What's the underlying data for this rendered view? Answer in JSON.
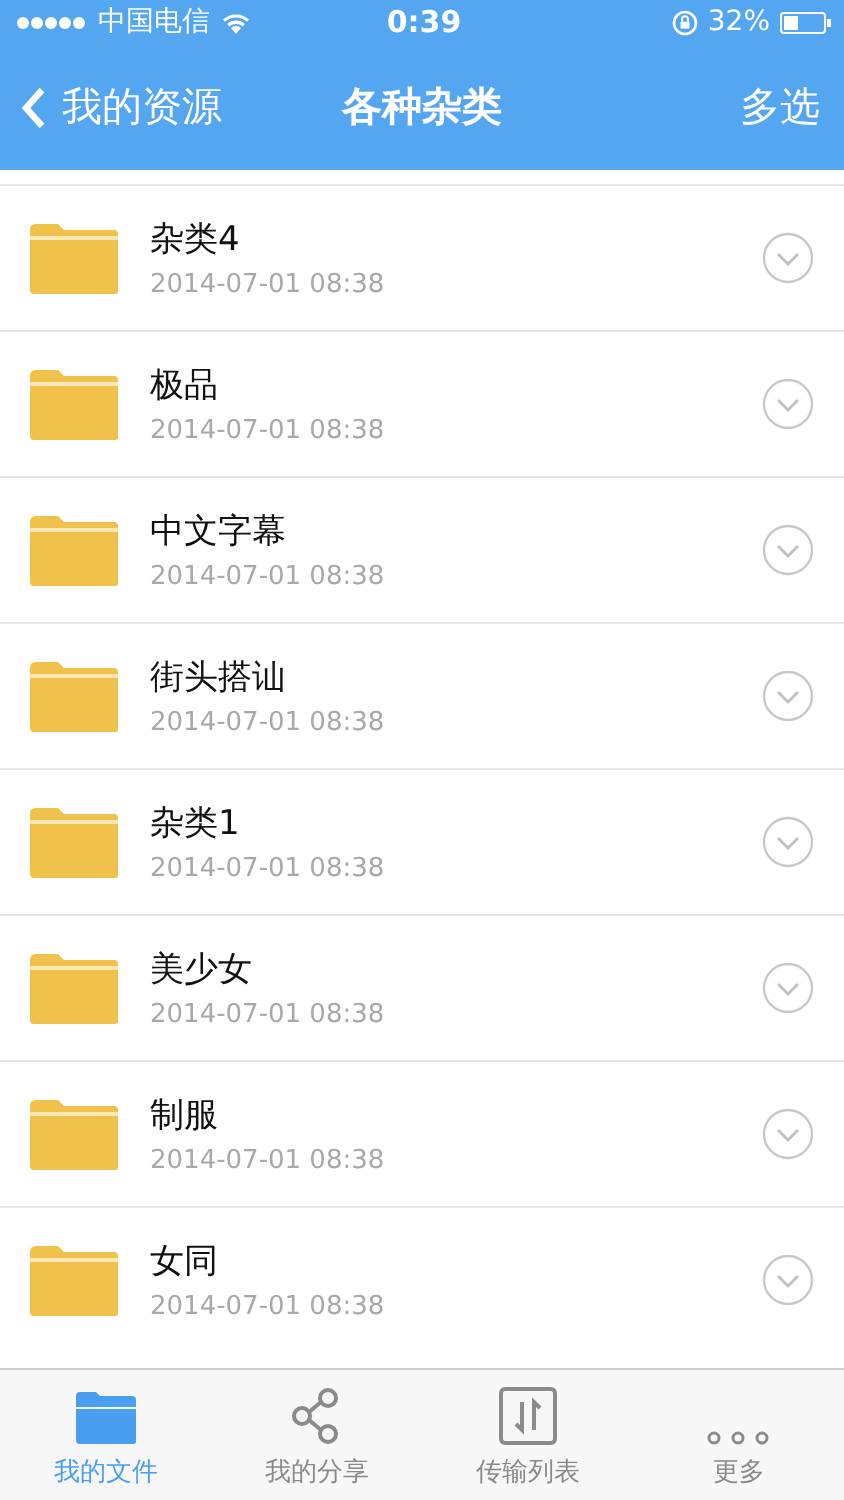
{
  "status_bar": {
    "carrier": "中国电信",
    "time": "0:39",
    "battery": "32%"
  },
  "nav": {
    "back": "我的资源",
    "title": "各种杂类",
    "action": "多选"
  },
  "files": [
    {
      "name": "杂类4",
      "date": "2014-07-01 08:38"
    },
    {
      "name": "极品",
      "date": "2014-07-01 08:38"
    },
    {
      "name": "中文字幕",
      "date": "2014-07-01 08:38"
    },
    {
      "name": "街头搭讪",
      "date": "2014-07-01 08:38"
    },
    {
      "name": "杂类1",
      "date": "2014-07-01 08:38"
    },
    {
      "name": "美少女",
      "date": "2014-07-01 08:38"
    },
    {
      "name": "制服",
      "date": "2014-07-01 08:38"
    },
    {
      "name": "女同",
      "date": "2014-07-01 08:38"
    }
  ],
  "tab_bar": [
    {
      "kind": "folder",
      "label": "我的文件",
      "selected": true
    },
    {
      "kind": "share",
      "label": "我的分享",
      "selected": false
    },
    {
      "kind": "transfer",
      "label": "传输列表",
      "selected": false
    },
    {
      "kind": "more",
      "label": "更多",
      "selected": false
    }
  ]
}
